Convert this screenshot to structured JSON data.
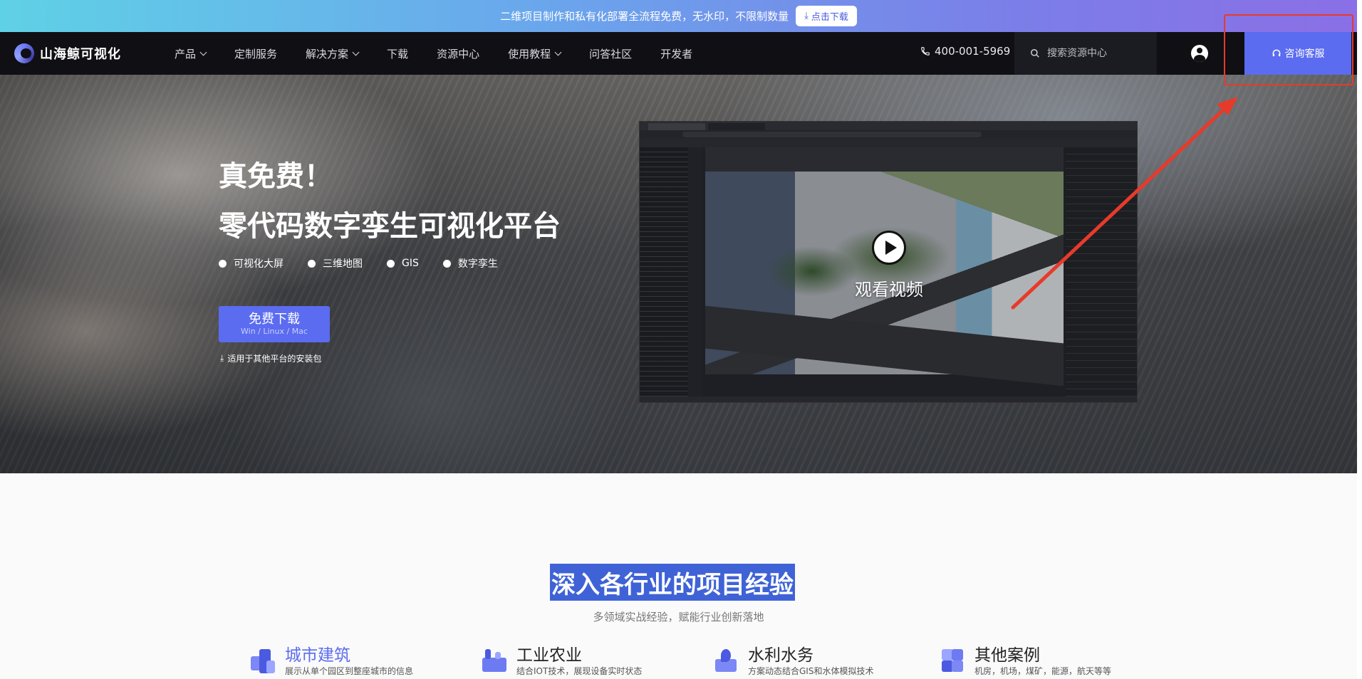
{
  "promo": {
    "text": "二维项目制作和私有化部署全流程免费，无水印，不限制数量",
    "button_label": "点击下载"
  },
  "nav": {
    "logo_text": "山海鲸可视化",
    "menu": [
      {
        "label": "产品",
        "has_dropdown": true
      },
      {
        "label": "定制服务",
        "has_dropdown": false
      },
      {
        "label": "解决方案",
        "has_dropdown": true
      },
      {
        "label": "下载",
        "has_dropdown": false
      },
      {
        "label": "资源中心",
        "has_dropdown": false
      },
      {
        "label": "使用教程",
        "has_dropdown": true
      },
      {
        "label": "问答社区",
        "has_dropdown": false
      },
      {
        "label": "开发者",
        "has_dropdown": false
      }
    ],
    "phone": "400-001-5969",
    "search_placeholder": "搜索资源中心",
    "consult_label": "咨询客服"
  },
  "hero": {
    "title_line1": "真免费！",
    "title_line2": "零代码数字孪生可视化平台",
    "features": [
      "可视化大屏",
      "三维地图",
      "GIS",
      "数字孪生"
    ],
    "download_label": "免费下载",
    "download_platforms": "Win / Linux / Mac",
    "other_platforms_link": "适用于其他平台的安装包",
    "video_label": "观看视频"
  },
  "industries": {
    "title": "深入各行业的项目经验",
    "subtitle": "多领域实战经验，赋能行业创新落地",
    "categories": [
      {
        "name": "城市建筑",
        "desc": "展示从单个园区到整座城市的信息",
        "active": true
      },
      {
        "name": "工业农业",
        "desc": "结合IOT技术，展现设备实时状态",
        "active": false
      },
      {
        "name": "水利水务",
        "desc": "方案动态结合GIS和水体模拟技术",
        "active": false
      },
      {
        "name": "其他案例",
        "desc": "机房，机场，煤矿，能源，航天等等",
        "active": false
      }
    ]
  },
  "colors": {
    "accent": "#5b6cf0",
    "nav_bg": "#0f0f14",
    "annotation": "#e83a2a",
    "title_highlight": "#3f63d6"
  }
}
